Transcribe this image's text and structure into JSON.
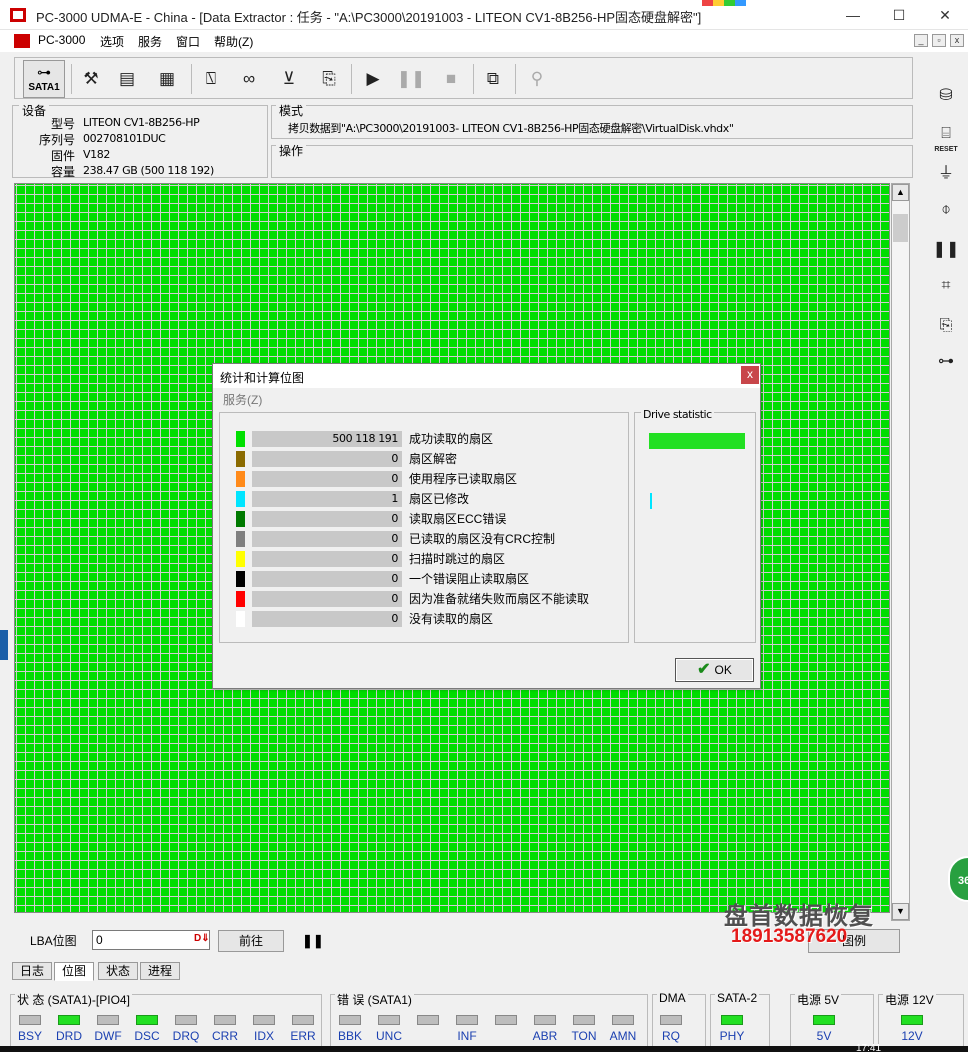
{
  "window": {
    "title": "PC-3000 UDMA-E - China - [Data Extractor : 任务 - \"A:\\PC3000\\20191003 - LITEON CV1-8B256-HP固态硬盘解密\"]",
    "minimize": "—",
    "maximize": "☐",
    "close": "✕"
  },
  "menu": {
    "app": "PC-3000",
    "options": "选项",
    "service": "服务",
    "window": "窗口",
    "help": "帮助(Z)",
    "mdi_min": "_",
    "mdi_restore": "▫",
    "mdi_close": "x"
  },
  "toolbar": {
    "sata_label": "SATA1"
  },
  "device": {
    "legend": "设备",
    "model_label": "型号",
    "model": "LITEON CV1-8B256-HP",
    "serial_label": "序列号",
    "serial": "002708101DUC",
    "firmware_label": "固件",
    "firmware": "V182",
    "capacity_label": "容量",
    "capacity": "238.47 GB (500 118 192)"
  },
  "mode": {
    "legend": "模式",
    "text": "拷贝数据到\"A:\\PC3000\\20191003- LITEON CV1-8B256-HP固态硬盘解密\\VirtualDisk.vhdx\""
  },
  "operation": {
    "legend": "操作"
  },
  "lba": {
    "label": "LBA位图",
    "value": "0",
    "forward_button": "前往",
    "legend_button": "图例"
  },
  "tabs": [
    {
      "label": "日志"
    },
    {
      "label": "位图"
    },
    {
      "label": "状态"
    },
    {
      "label": "进程"
    }
  ],
  "status": {
    "groups": [
      {
        "title": "状 态 (SATA1)-[PIO4]",
        "indicators": [
          {
            "label": "BSY",
            "on": false
          },
          {
            "label": "DRD",
            "on": true
          },
          {
            "label": "DWF",
            "on": false
          },
          {
            "label": "DSC",
            "on": true
          },
          {
            "label": "DRQ",
            "on": false
          },
          {
            "label": "CRR",
            "on": false
          },
          {
            "label": "IDX",
            "on": false
          },
          {
            "label": "ERR",
            "on": false
          }
        ]
      },
      {
        "title": "错 误 (SATA1)",
        "indicators": [
          {
            "label": "BBK",
            "on": false
          },
          {
            "label": "UNC",
            "on": false
          },
          {
            "label": "",
            "on": false
          },
          {
            "label": "INF",
            "on": false
          },
          {
            "label": "",
            "on": false
          },
          {
            "label": "ABR",
            "on": false
          },
          {
            "label": "TON",
            "on": false
          },
          {
            "label": "AMN",
            "on": false
          }
        ]
      },
      {
        "title": "DMA",
        "indicators": [
          {
            "label": "RQ",
            "on": false
          }
        ]
      },
      {
        "title": "SATA-2",
        "indicators": [
          {
            "label": "PHY",
            "on": true
          }
        ]
      },
      {
        "title": "电源 5V",
        "indicators": [
          {
            "label": "5V",
            "on": true
          }
        ]
      },
      {
        "title": "电源 12V",
        "indicators": [
          {
            "label": "12V",
            "on": true
          }
        ]
      }
    ]
  },
  "dialog": {
    "title": "统计和计算位图",
    "close": "x",
    "menu": "服务(Z)",
    "drive_statistic": "Drive statistic",
    "drive_fill_fraction": 0.98,
    "ok_button": "OK",
    "rows": [
      {
        "color": "#00e000",
        "value": "500 118 191",
        "label": "成功读取的扇区"
      },
      {
        "color": "#8a6a00",
        "value": "0",
        "label": "扇区解密"
      },
      {
        "color": "#ff8a1a",
        "value": "0",
        "label": "使用程序已读取扇区"
      },
      {
        "color": "#00e5ff",
        "value": "1",
        "label": "扇区已修改"
      },
      {
        "color": "#007a00",
        "value": "0",
        "label": "读取扇区ECC错误"
      },
      {
        "color": "#808080",
        "value": "0",
        "label": "已读取的扇区没有CRC控制"
      },
      {
        "color": "#ffff00",
        "value": "0",
        "label": "扫描时跳过的扇区"
      },
      {
        "color": "#000000",
        "value": "0",
        "label": "一个错误阻止读取扇区"
      },
      {
        "color": "#ff0000",
        "value": "0",
        "label": "因为准备就绪失败而扇区不能读取"
      },
      {
        "color": "#ffffff",
        "value": "0",
        "label": "没有读取的扇区"
      }
    ]
  },
  "watermark": {
    "line1": "盘首数据恢复",
    "line2": "18913587620"
  },
  "taskbar": {
    "clock": "17:41",
    "badge": "36"
  },
  "colors": {
    "sector_ok": "#00dd00",
    "indicator_on": "#22e022",
    "indicator_off": "#bdbdbd"
  }
}
